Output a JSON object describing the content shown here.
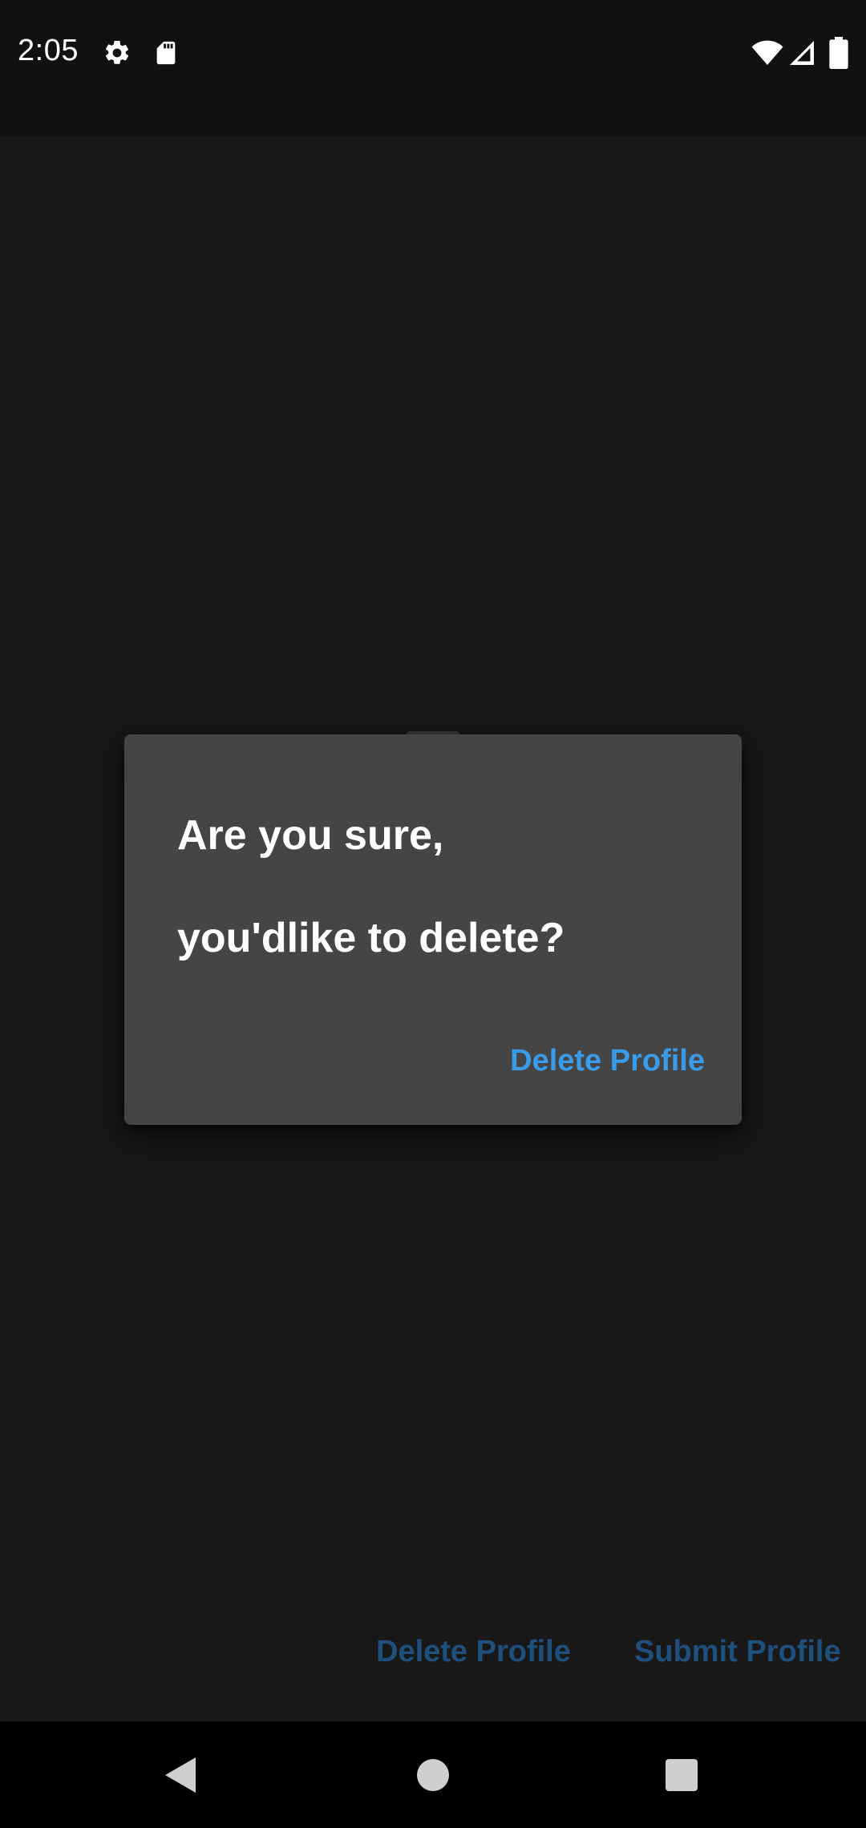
{
  "status_bar": {
    "time": "2:05",
    "icons": [
      "settings-icon",
      "sd-card-icon",
      "wifi-icon",
      "cell-signal-icon",
      "battery-icon"
    ]
  },
  "background_actions": {
    "delete_label": "Delete Profile",
    "submit_label": "Submit Profile"
  },
  "dialog": {
    "title_line1": "Are you sure,",
    "title_line2": "you'dlike to delete?",
    "action_label": "Delete Profile"
  },
  "navigation": {
    "icons": [
      "back-icon",
      "home-icon",
      "recents-icon"
    ]
  },
  "colors": {
    "background": "#181818",
    "status_bar": "#111111",
    "dialog": "#454545",
    "accent": "#3a9be8",
    "dimmed_accent": "#1f4f7c"
  }
}
